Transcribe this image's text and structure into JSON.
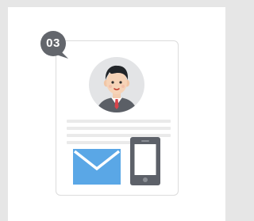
{
  "step": {
    "number": "03",
    "badge_color": "#63666c"
  },
  "icons": {
    "avatar": "businessman-avatar-icon",
    "mail": "envelope-icon",
    "phone": "smartphone-icon"
  },
  "colors": {
    "mail_blue": "#5aa7e6",
    "phone_gray": "#5d6169",
    "line_gray": "#eaeaea",
    "card_border": "#dcdcdc",
    "background": "#e6e6e6"
  }
}
